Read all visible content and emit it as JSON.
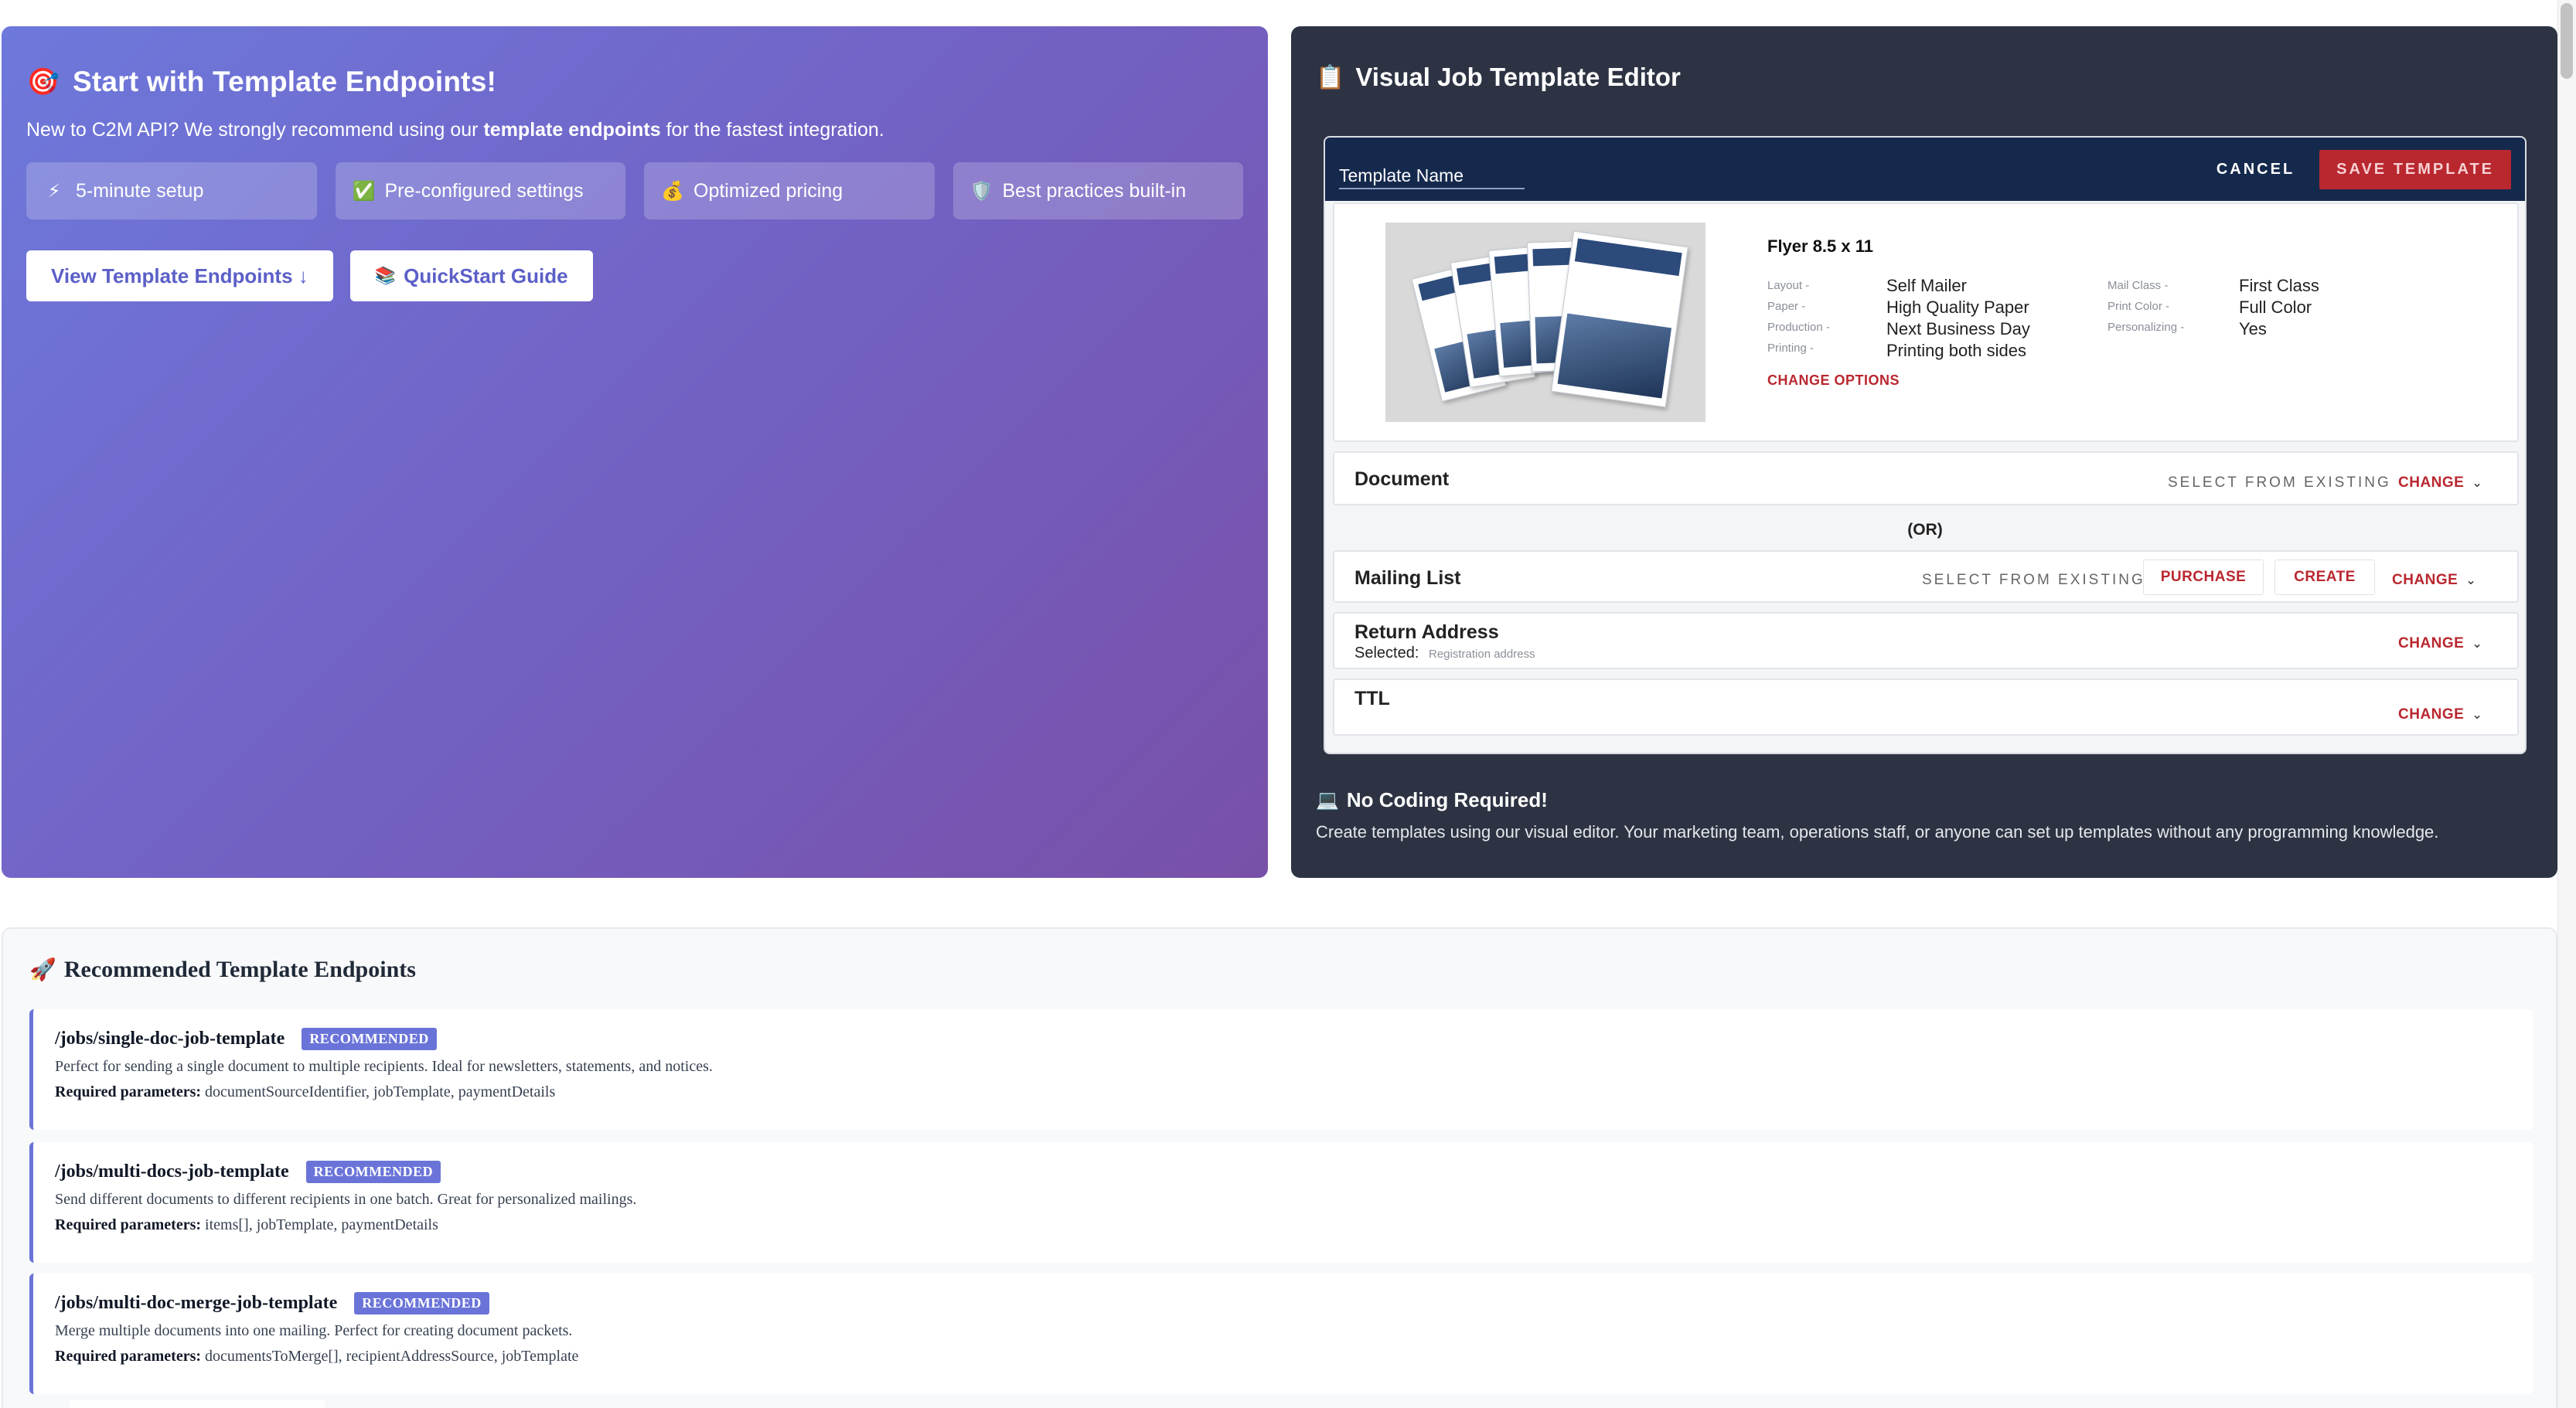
{
  "hero": {
    "title_icon": "🎯",
    "title": "Start with Template Endpoints!",
    "subtitle_prefix": "New to C2M API? We strongly recommend using our ",
    "subtitle_bold": "template endpoints",
    "subtitle_suffix": " for the fastest integration.",
    "features": [
      {
        "icon": "⚡",
        "label": "5-minute setup"
      },
      {
        "icon": "✅",
        "label": "Pre-configured settings"
      },
      {
        "icon": "💰",
        "label": "Optimized pricing"
      },
      {
        "icon": "🛡️",
        "label": "Best practices built-in"
      }
    ],
    "buttons": {
      "view_templates": "View Template Endpoints ↓",
      "quickstart_icon": "📚",
      "quickstart": "QuickStart Guide"
    },
    "gradient": [
      "#6d79db",
      "#7850a8"
    ]
  },
  "editor": {
    "title_icon": "📋",
    "title": "Visual Job Template Editor",
    "mock": {
      "template_name": "Template Name",
      "cancel": "CANCEL",
      "save": "SAVE TEMPLATE",
      "product": {
        "name": "Flyer 8.5 x 11",
        "specs_left": [
          {
            "label": "Layout -",
            "value": "Self Mailer"
          },
          {
            "label": "Paper -",
            "value": "High Quality Paper"
          },
          {
            "label": "Production -",
            "value": "Next Business Day"
          },
          {
            "label": "Printing -",
            "value": "Printing both sides"
          }
        ],
        "specs_right": [
          {
            "label": "Mail Class -",
            "value": "First Class"
          },
          {
            "label": "Print Color -",
            "value": "Full Color"
          },
          {
            "label": "Personalizing -",
            "value": "Yes"
          }
        ],
        "change_options": "CHANGE OPTIONS"
      },
      "document": {
        "label": "Document",
        "select": "SELECT FROM EXISTING",
        "change": "CHANGE"
      },
      "or": "(OR)",
      "mailing_list": {
        "label": "Mailing List",
        "select": "SELECT FROM EXISTING",
        "purchase": "PURCHASE",
        "create": "CREATE",
        "change": "CHANGE"
      },
      "return_address": {
        "label": "Return Address",
        "selected_label": "Selected:",
        "selected_value": "Registration address",
        "change": "CHANGE"
      },
      "ttl": {
        "label": "TTL",
        "change": "CHANGE"
      }
    },
    "no_coding": {
      "icon": "💻",
      "title": "No Coding Required!",
      "description": "Create templates using our visual editor. Your marketing team, operations staff, or anyone can set up templates without any programming knowledge."
    },
    "background": "#2d3343",
    "accent": "#b9272f"
  },
  "recommended": {
    "icon": "🚀",
    "title": "Recommended Template Endpoints",
    "badge": "RECOMMENDED",
    "required_label": "Required parameters:",
    "endpoints": [
      {
        "path": "/jobs/single-doc-job-template",
        "description": "Perfect for sending a single document to multiple recipients. Ideal for newsletters, statements, and notices.",
        "params": "documentSourceIdentifier, jobTemplate, paymentDetails"
      },
      {
        "path": "/jobs/multi-docs-job-template",
        "description": "Send different documents to different recipients in one batch. Great for personalized mailings.",
        "params": "items[], jobTemplate, paymentDetails"
      },
      {
        "path": "/jobs/multi-doc-merge-job-template",
        "description": "Merge multiple documents into one mailing. Perfect for creating document packets.",
        "params": "documentsToMerge[], recipientAddressSource, jobTemplate"
      }
    ],
    "accent": "#6a74d8"
  }
}
